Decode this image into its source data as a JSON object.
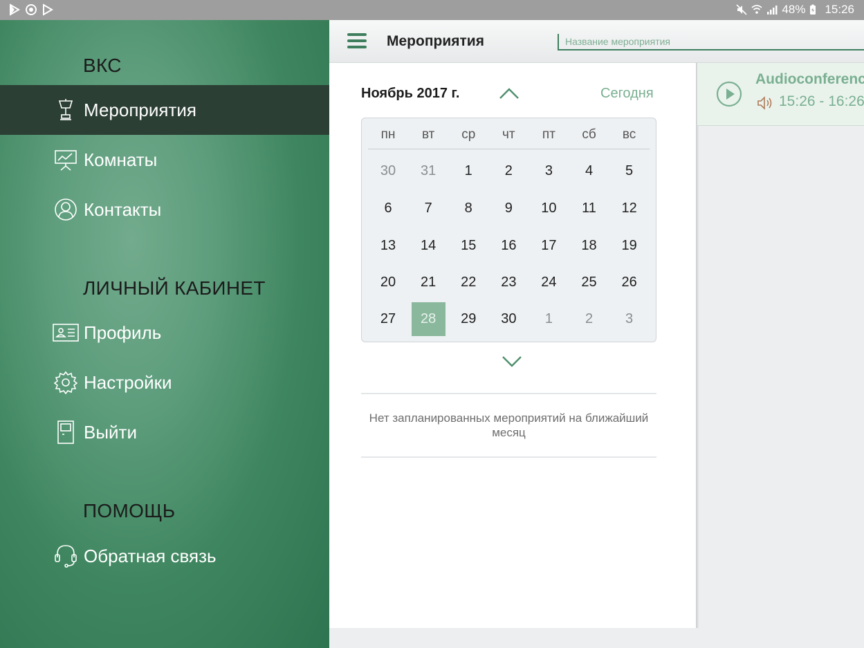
{
  "status_bar": {
    "battery": "48%",
    "time": "15:26",
    "left_icons": [
      "play-store-icon",
      "sync-icon",
      "play-icon"
    ],
    "right_icons": [
      "mute-icon",
      "wifi-icon",
      "signal-icon",
      "battery-icon"
    ]
  },
  "sidebar": {
    "section_vks": "ВКС",
    "section_account": "ЛИЧНЫЙ КАБИНЕТ",
    "section_help": "ПОМОЩЬ",
    "items": [
      {
        "label": "Мероприятия",
        "icon": "presentation-icon",
        "active": true
      },
      {
        "label": "Комнаты",
        "icon": "board-icon",
        "active": false
      },
      {
        "label": "Контакты",
        "icon": "contact-icon",
        "active": false
      },
      {
        "label": "Профиль",
        "icon": "id-card-icon",
        "active": false
      },
      {
        "label": "Настройки",
        "icon": "gear-icon",
        "active": false
      },
      {
        "label": "Выйти",
        "icon": "door-icon",
        "active": false
      },
      {
        "label": "Обратная связь",
        "icon": "headset-icon",
        "active": false
      }
    ]
  },
  "header": {
    "title": "Мероприятия",
    "search_placeholder": "Название мероприятия"
  },
  "calendar": {
    "month_label": "Ноябрь 2017 г.",
    "today_label": "Сегодня",
    "weekdays": [
      "пн",
      "вт",
      "ср",
      "чт",
      "пт",
      "сб",
      "вс"
    ],
    "weeks": [
      [
        "30",
        "31",
        "1",
        "2",
        "3",
        "4",
        "5"
      ],
      [
        "6",
        "7",
        "8",
        "9",
        "10",
        "11",
        "12"
      ],
      [
        "13",
        "14",
        "15",
        "16",
        "17",
        "18",
        "19"
      ],
      [
        "20",
        "21",
        "22",
        "23",
        "24",
        "25",
        "26"
      ],
      [
        "27",
        "28",
        "29",
        "30",
        "1",
        "2",
        "3"
      ]
    ],
    "selected_day": "28",
    "empty_message": "Нет запланированных мероприятий на ближайший месяц"
  },
  "event": {
    "title": "Audioconference",
    "time": "15:26 - 16:26"
  },
  "colors": {
    "accent": "#3e7e5d",
    "accent_light": "#7aaf91",
    "selected_day_bg": "#8ab89d",
    "active_nav_bg": "#2b3f34"
  }
}
